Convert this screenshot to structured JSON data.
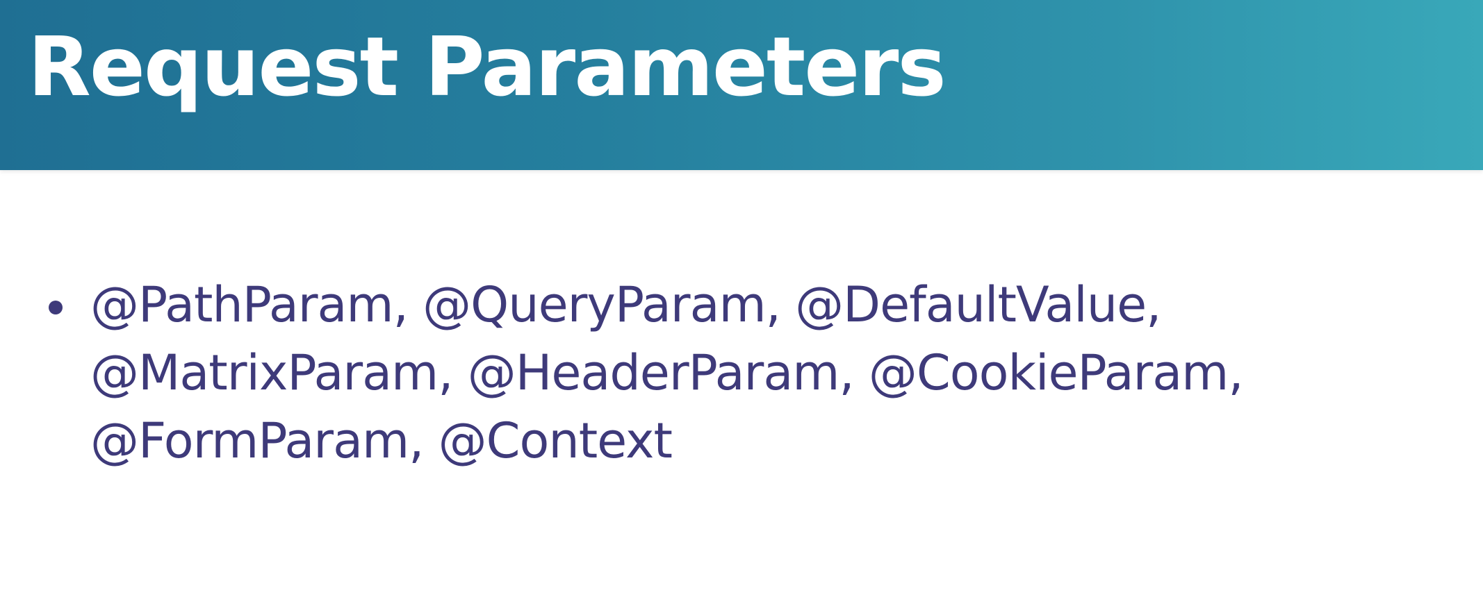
{
  "slide": {
    "title": "Request Parameters",
    "bullets": [
      {
        "lines": [
          "@PathParam, @QueryParam, @DefaultValue,",
          "@MatrixParam, @HeaderParam, @CookieParam,",
          "@FormParam, @Context"
        ]
      }
    ]
  },
  "colors": {
    "header_start": "#1f6f93",
    "header_end": "#39a8b9",
    "title_text": "#ffffff",
    "body_text": "#3e3a7a",
    "background": "#ffffff"
  }
}
